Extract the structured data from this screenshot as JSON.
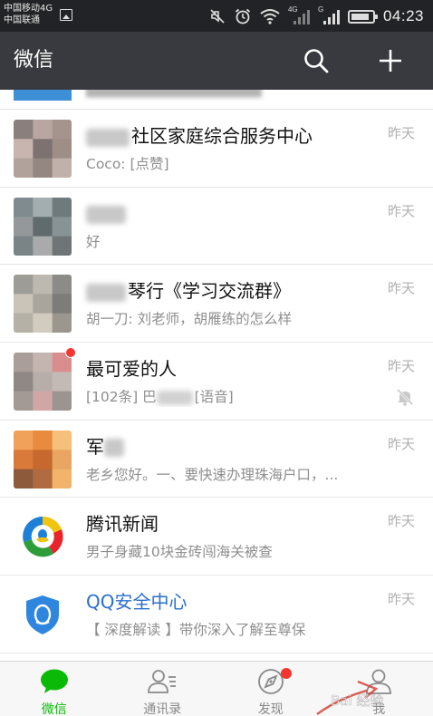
{
  "status_bar": {
    "carrier_line1": "中国移动4G",
    "carrier_line2": "中国联通",
    "network_tag_1": "4G",
    "network_tag_2": "G",
    "time": "04:23",
    "battery_level": 0.85,
    "icons": [
      "image-icon",
      "mute-icon",
      "alarm-icon",
      "wifi-icon",
      "signal-icon",
      "signal-icon",
      "battery-icon"
    ]
  },
  "nav": {
    "title": "微信",
    "icons": [
      "search-icon",
      "plus-icon"
    ]
  },
  "chats": [
    {
      "name_blurred": true,
      "name": "社区家庭综合服务中心",
      "preview": "Coco: [点赞]",
      "time": "昨天",
      "avatar_colors": [
        "#8a7f7c",
        "#b9a6a3",
        "#a5938d",
        "#c9b5b0",
        "#7d7270",
        "#9e8e86",
        "#b2a29c",
        "#948781",
        "#c1b1ab"
      ]
    },
    {
      "name_blurred": true,
      "name": "",
      "preview": "好",
      "time": "昨天",
      "avatar_colors": [
        "#7f8b8e",
        "#a3aeb0",
        "#6e7a7c",
        "#95989a",
        "#5f6b6c",
        "#889395",
        "#7a8486",
        "#a9aaab",
        "#6f7476"
      ]
    },
    {
      "name_blurred": true,
      "name": "琴行《学习交流群》",
      "preview": "胡一刀: 刘老师，胡雁练的怎么样",
      "time": "昨天",
      "avatar_colors": [
        "#9e9c96",
        "#bdb9b1",
        "#8c8b87",
        "#c9c3b8",
        "#a9a59c",
        "#7d7c78",
        "#b6b1a6",
        "#d1cbc0",
        "#9b978f"
      ]
    },
    {
      "name_blurred": false,
      "name": "最可爱的人",
      "preview_prefix": "[102条] 巴",
      "preview_suffix": "[语音]",
      "time": "昨天",
      "unread_dot": true,
      "muted": true,
      "avatar_colors": [
        "#a99e9a",
        "#c5b5b1",
        "#d98d8c",
        "#8f8885",
        "#b7ada9",
        "#c3bab5",
        "#a49a95",
        "#d1a7a5",
        "#9c9490"
      ]
    },
    {
      "name_blurred": true,
      "name": "军",
      "preview": "老乡您好。一、要快速办理珠海户口，...",
      "time": "昨天",
      "avatar_colors": [
        "#f0a25a",
        "#e88b3e",
        "#f5c07a",
        "#d97a3a",
        "#c7692f",
        "#e9a663",
        "#8d5a3c",
        "#b06c40",
        "#f2b46b"
      ]
    },
    {
      "name_blurred": false,
      "name": "腾讯新闻",
      "preview": "男子身藏10块金砖闯海关被查",
      "time": "昨天",
      "avatar_icon": "tencent-news-icon"
    },
    {
      "name_blurred": false,
      "name": "QQ安全中心",
      "name_color": "#2a6fd0",
      "preview": "【 深度解读 】带你深入了解至尊保",
      "time": "昨天",
      "avatar_icon": "qq-security-shield-icon"
    }
  ],
  "tabs": [
    {
      "label": "微信",
      "icon": "chat-bubble-icon",
      "active": true
    },
    {
      "label": "通讯录",
      "icon": "contacts-icon",
      "active": false
    },
    {
      "label": "发现",
      "icon": "compass-icon",
      "active": false,
      "dot": true
    },
    {
      "label": "我",
      "icon": "person-icon",
      "active": false
    }
  ],
  "colors": {
    "nav_bg": "#393a3f",
    "status_bg": "#222326",
    "accent_green": "#09bb07",
    "badge_red": "#f43530",
    "link_blue": "#2a6fd0"
  }
}
